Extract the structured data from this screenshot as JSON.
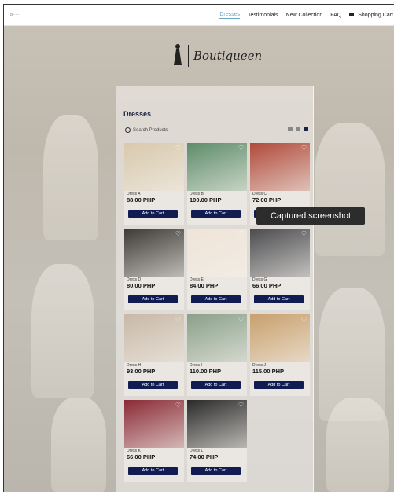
{
  "topbar": {
    "logo_small": "B·····",
    "nav": [
      "Dresses",
      "Testimonials",
      "New Collection",
      "FAQ"
    ],
    "cart_label": "Shopping Cart"
  },
  "brand": {
    "name": "Boutiqueen"
  },
  "panel": {
    "title": "Dresses",
    "search_placeholder": "Search Products"
  },
  "products": [
    {
      "name": "Dress A",
      "price": "88.00 PHP",
      "button": "Add to Cart",
      "color": "#d9c9ad"
    },
    {
      "name": "Dress B",
      "price": "100.00 PHP",
      "button": "Add to Cart",
      "color": "#5d8c6a"
    },
    {
      "name": "Dress C",
      "price": "72.00 PHP",
      "button": "Add to Cart",
      "color": "#b04a3a"
    },
    {
      "name": "Dress D",
      "price": "80.00 PHP",
      "button": "Add to Cart",
      "color": "#3d3a36"
    },
    {
      "name": "Dress E",
      "price": "84.00 PHP",
      "button": "Add to Cart",
      "color": "#efe4d8"
    },
    {
      "name": "Dress G",
      "price": "66.00 PHP",
      "button": "Add to Cart",
      "color": "#4b4b4f"
    },
    {
      "name": "Dress H",
      "price": "93.00 PHP",
      "button": "Add to Cart",
      "color": "#c8b8a7"
    },
    {
      "name": "Dress I",
      "price": "110.00 PHP",
      "button": "Add to Cart",
      "color": "#8aa08a"
    },
    {
      "name": "Dress J",
      "price": "115.00 PHP",
      "button": "Add to Cart",
      "color": "#c9a06d"
    },
    {
      "name": "Dress K",
      "price": "66.00 PHP",
      "button": "Add to Cart",
      "color": "#8a2a36"
    },
    {
      "name": "Dress L",
      "price": "74.00 PHP",
      "button": "Add to Cart",
      "color": "#2a2a2a"
    }
  ],
  "tooltip": "Captured screenshot",
  "colors": {
    "accent": "#101c52",
    "active_nav": "#6aa6c8"
  }
}
